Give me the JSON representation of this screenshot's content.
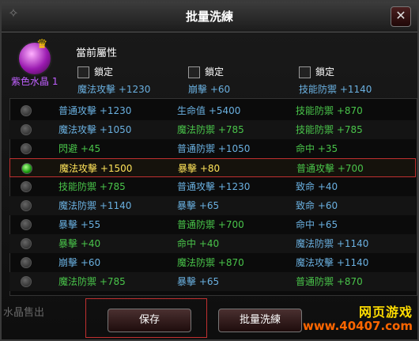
{
  "window": {
    "title": "批量洗練",
    "close": "✕"
  },
  "crystal": {
    "label": "紫色水晶 1"
  },
  "current": {
    "label": "當前屬性",
    "locks": [
      {
        "label": "鎖定",
        "attr": "魔法攻擊 +1230"
      },
      {
        "label": "鎖定",
        "attr": "崩擊 +60"
      },
      {
        "label": "鎖定",
        "attr": "技能防禦 +1140"
      }
    ]
  },
  "rows": [
    {
      "a": "普通攻擊 +1230",
      "b": "生命值 +5400",
      "c": "技能防禦 +870"
    },
    {
      "a": "魔法攻擊 +1050",
      "b": "魔法防禦 +785",
      "c": "技能防禦 +785"
    },
    {
      "a": "閃避 +45",
      "b": "普通防禦 +1050",
      "c": "命中 +35"
    },
    {
      "a": "魔法攻擊 +1500",
      "b": "暴擊 +80",
      "c": "普通攻擊 +700"
    },
    {
      "a": "技能防禦 +785",
      "b": "普通攻擊 +1230",
      "c": "致命 +40"
    },
    {
      "a": "魔法防禦 +1140",
      "b": "暴擊 +65",
      "c": "致命 +60"
    },
    {
      "a": "暴擊 +55",
      "b": "普通防禦 +700",
      "c": "命中 +65"
    },
    {
      "a": "暴擊 +40",
      "b": "命中 +40",
      "c": "魔法防禦 +1140"
    },
    {
      "a": "崩擊 +60",
      "b": "魔法防禦 +870",
      "c": "魔法攻擊 +1140"
    },
    {
      "a": "魔法防禦 +785",
      "b": "暴擊 +65",
      "c": "普通防禦 +870"
    }
  ],
  "footer": {
    "sell": "水晶售出",
    "save": "保存",
    "batch": "批量洗練"
  },
  "watermark": {
    "line1": "网页游戏",
    "line2": "www.40407.com"
  }
}
